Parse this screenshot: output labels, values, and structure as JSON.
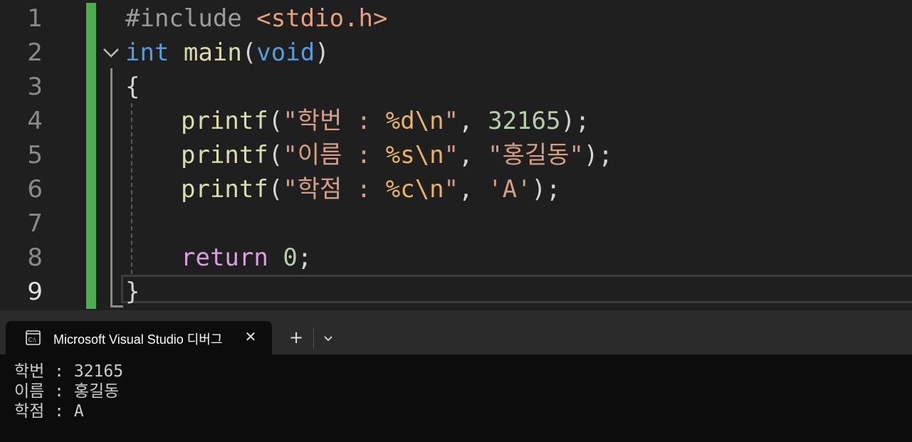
{
  "editor": {
    "line_numbers": [
      "1",
      "2",
      "3",
      "4",
      "5",
      "6",
      "7",
      "8",
      "9"
    ],
    "lines": {
      "l1": {
        "pp": "#include ",
        "inc": "<stdio.h>"
      },
      "l2": {
        "kw1": "int",
        "sp": " ",
        "fn": "main",
        "open": "(",
        "kw2": "void",
        "close": ")"
      },
      "l3": {
        "brace": "{"
      },
      "l4": {
        "indent": "  ",
        "fn": "printf",
        "p1": "(",
        "s1": "\"학번 : ",
        "fmt": "%d\\n",
        "s2": "\"",
        "comma": ", ",
        "num": "32165",
        "p2": ");"
      },
      "l5": {
        "indent": "  ",
        "fn": "printf",
        "p1": "(",
        "s1": "\"이름 : ",
        "fmt": "%s\\n",
        "s2": "\"",
        "comma": ", ",
        "arg": "\"홍길동\"",
        "p2": ");"
      },
      "l6": {
        "indent": "  ",
        "fn": "printf",
        "p1": "(",
        "s1": "\"학점 : ",
        "fmt": "%c\\n",
        "s2": "\"",
        "comma": ", ",
        "arg": "'A'",
        "p2": ");"
      },
      "l8": {
        "indent": "  ",
        "kw": "return",
        "sp": " ",
        "num": "0",
        "semi": ";"
      },
      "l9": {
        "brace": "}"
      }
    },
    "active_line": "9"
  },
  "terminal": {
    "tab_title": "Microsoft Visual Studio 디버그",
    "close_glyph": "✕",
    "new_tab_glyph": "+",
    "output_lines": [
      "학번 : 32165",
      "이름 : 홍길동",
      "학점 : A"
    ]
  },
  "colors": {
    "change_bar": "#4cae4f",
    "keyword": "#569cd6",
    "function": "#dcdcaa",
    "string": "#d69d85",
    "number": "#b5cea8",
    "control": "#d8a0df"
  }
}
